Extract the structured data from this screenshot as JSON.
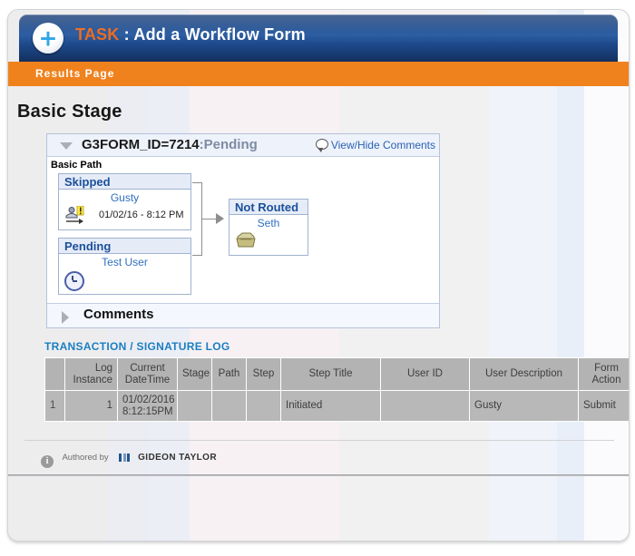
{
  "header": {
    "plus_icon": "plus-icon",
    "keyword": "TASK",
    "separator": " : ",
    "title": "Add a Workflow Form",
    "subbar_label": "Results Page",
    "bar_color": "#1e4a8c",
    "accent_color": "#f0821e"
  },
  "stage": {
    "title": "Basic Stage"
  },
  "workflow": {
    "header": {
      "collapse_icon": "triangle-down-icon",
      "form_id": "G3FORM_ID=7214",
      "state": ":Pending",
      "comments_icon": "speech-bubble-icon",
      "comments_link": "View/Hide Comments"
    },
    "path_label": "Basic Path",
    "nodes": [
      {
        "status": "Skipped",
        "user": "Gusty",
        "icon": "user-skip-icon",
        "datetime": "01/02/16 - 8:12 PM",
        "status_color": "#1b4f9c"
      },
      {
        "status": "Pending",
        "user": "Test User",
        "icon": "clock-icon",
        "datetime": "",
        "status_color": "#1b4f9c"
      },
      {
        "status": "Not Routed",
        "user": "Seth",
        "icon": "inbox-tray-icon",
        "datetime": "",
        "status_color": "#1b4f9c"
      }
    ],
    "comments_section": {
      "expand_icon": "triangle-right-icon",
      "label": "Comments"
    }
  },
  "log": {
    "title": "TRANSACTION / SIGNATURE LOG",
    "columns": [
      "",
      "Log Instance",
      "Current DateTime",
      "Stage",
      "Path",
      "Step",
      "Step Title",
      "User ID",
      "User Description",
      "Form Action",
      ""
    ],
    "rows": [
      {
        "index": "1",
        "log_instance": "1",
        "current_datetime": "01/02/2016 8:12:15PM",
        "stage": "",
        "path": "",
        "step": "",
        "step_title": "Initiated",
        "user_id": "",
        "user_description": "Gusty",
        "form_action": "Submit",
        "extra": ""
      }
    ]
  },
  "footer": {
    "info_icon": "info-icon",
    "authored_by": "Authored by",
    "logo_icon": "gideon-taylor-bars-icon",
    "company": "GIDEON TAYLOR"
  }
}
